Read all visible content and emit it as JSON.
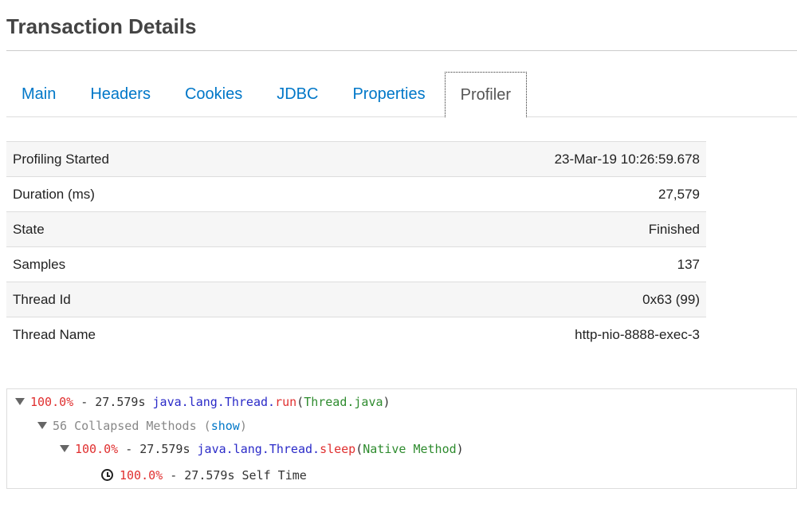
{
  "page": {
    "title": "Transaction Details"
  },
  "tabs": [
    {
      "label": "Main",
      "active": false
    },
    {
      "label": "Headers",
      "active": false
    },
    {
      "label": "Cookies",
      "active": false
    },
    {
      "label": "JDBC",
      "active": false
    },
    {
      "label": "Properties",
      "active": false
    },
    {
      "label": "Profiler",
      "active": true
    }
  ],
  "details": [
    {
      "label": "Profiling Started",
      "value": "23-Mar-19 10:26:59.678"
    },
    {
      "label": "Duration (ms)",
      "value": "27,579"
    },
    {
      "label": "State",
      "value": "Finished"
    },
    {
      "label": "Samples",
      "value": "137"
    },
    {
      "label": "Thread Id",
      "value": "0x63 (99)"
    },
    {
      "label": "Thread Name",
      "value": "http-nio-8888-exec-3"
    }
  ],
  "profile": {
    "root": {
      "percent": "100.0%",
      "sep": " - ",
      "time": "27.579s",
      "class": "java.lang.Thread",
      "dot": ".",
      "method": "run",
      "paren_open": "(",
      "source": "Thread.java",
      "paren_close": ")"
    },
    "collapsed": {
      "text": "56 Collapsed Methods (",
      "link": "show",
      "close": ")"
    },
    "child": {
      "percent": "100.0%",
      "sep": " - ",
      "time": "27.579s",
      "class": "java.lang.Thread",
      "dot": ".",
      "method": "sleep",
      "paren_open": "(",
      "source": "Native Method",
      "paren_close": ")"
    },
    "self": {
      "icon": "clock-icon",
      "percent": "100.0%",
      "sep": " - ",
      "time": "27.579s",
      "label": "Self Time"
    }
  },
  "colors": {
    "link": "#0077c8",
    "percent": "#e03030",
    "class": "#2a2ac8",
    "source": "#2e8b2e"
  }
}
